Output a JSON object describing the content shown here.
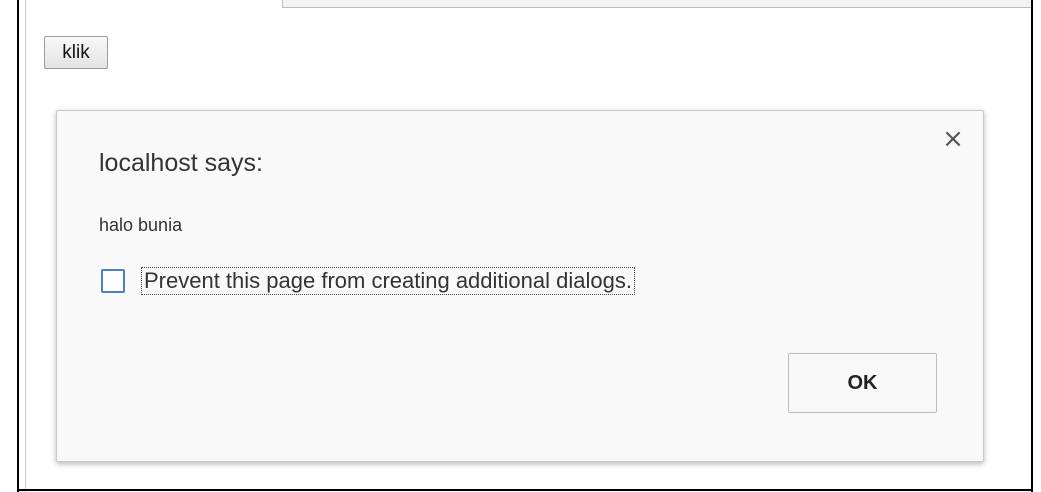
{
  "page": {
    "button_label": "klik"
  },
  "dialog": {
    "title": "localhost says:",
    "message": "halo bunia",
    "close_symbol": "×",
    "checkbox_label": "Prevent this page from creating additional dialogs.",
    "checkbox_checked": false,
    "ok_label": "OK"
  },
  "colors": {
    "checkbox_border": "#4d7fc7",
    "dialog_background": "#f9f9f9"
  },
  "icons": {
    "close": "close-icon"
  }
}
